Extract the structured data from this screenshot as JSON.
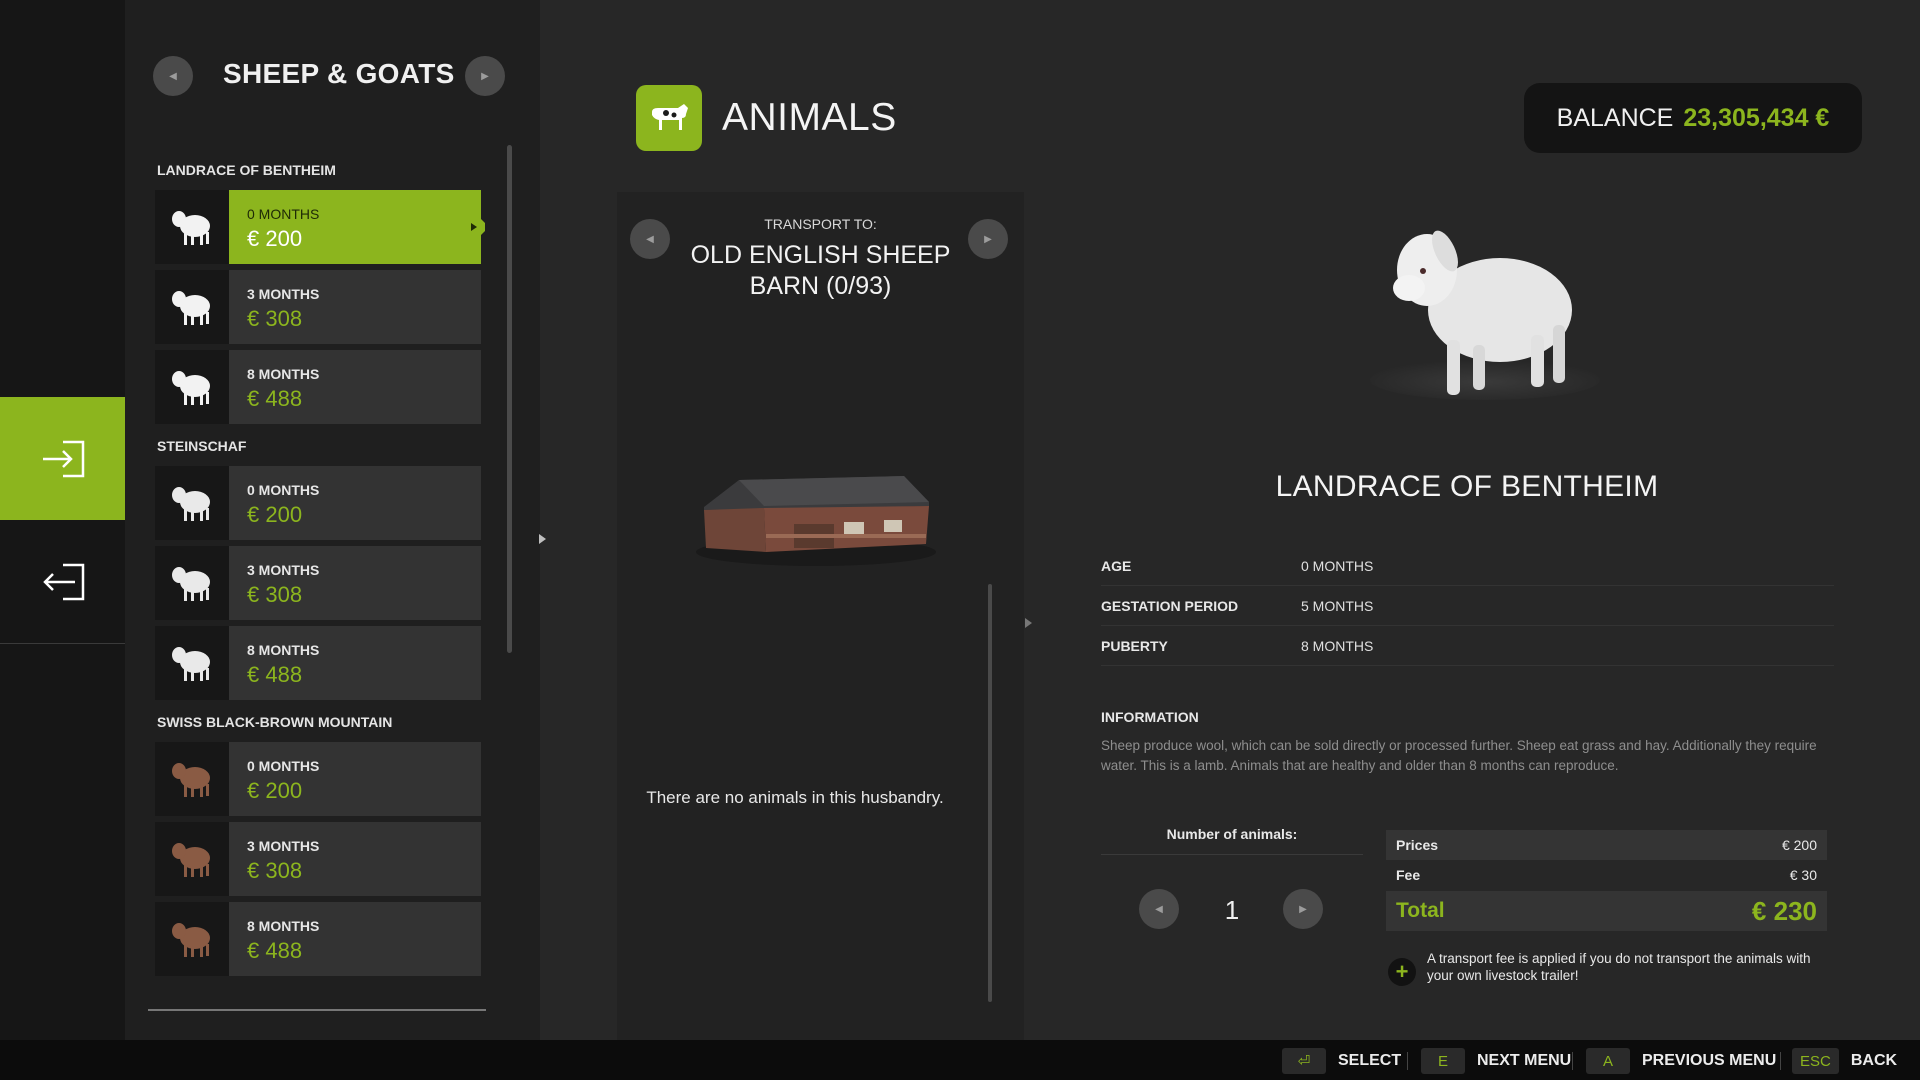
{
  "list": {
    "title": "SHEEP & GOATS",
    "groups": [
      {
        "name": "LANDRACE OF BENTHEIM",
        "wool_color": "#f2f2f2",
        "items": [
          {
            "age": "0 MONTHS",
            "price": "€ 200",
            "selected": true
          },
          {
            "age": "3 MONTHS",
            "price": "€ 308",
            "selected": false
          },
          {
            "age": "8 MONTHS",
            "price": "€ 488",
            "selected": false
          }
        ]
      },
      {
        "name": "STEINSCHAF",
        "wool_color": "#e9e9e9",
        "items": [
          {
            "age": "0 MONTHS",
            "price": "€ 200",
            "selected": false
          },
          {
            "age": "3 MONTHS",
            "price": "€ 308",
            "selected": false
          },
          {
            "age": "8 MONTHS",
            "price": "€ 488",
            "selected": false
          }
        ]
      },
      {
        "name": "SWISS BLACK-BROWN MOUNTAIN",
        "wool_color": "#8a5b44",
        "items": [
          {
            "age": "0 MONTHS",
            "price": "€ 200",
            "selected": false
          },
          {
            "age": "3 MONTHS",
            "price": "€ 308",
            "selected": false
          },
          {
            "age": "8 MONTHS",
            "price": "€ 488",
            "selected": false
          }
        ]
      }
    ]
  },
  "header": {
    "title": "ANIMALS",
    "icon": "cow-icon",
    "balance_label": "BALANCE",
    "balance_value": "23,305,434 €"
  },
  "transport": {
    "label": "TRANSPORT TO:",
    "destination": "OLD ENGLISH SHEEP BARN (0/93)",
    "empty_message": "There are no animals in this husbandry."
  },
  "detail": {
    "breed": "LANDRACE OF BENTHEIM",
    "stats": [
      {
        "label": "AGE",
        "value": "0 MONTHS"
      },
      {
        "label": "GESTATION PERIOD",
        "value": "5 MONTHS"
      },
      {
        "label": "PUBERTY",
        "value": "8 MONTHS"
      }
    ],
    "info_heading": "INFORMATION",
    "info_text": "Sheep produce wool, which can be sold directly or processed further. Sheep eat grass and hay. Additionally they require water. This is a lamb. Animals that are healthy and older than 8 months can reproduce."
  },
  "purchase": {
    "number_label": "Number of animals:",
    "quantity": "1",
    "prices_label": "Prices",
    "prices_value": "€ 200",
    "fee_label": "Fee",
    "fee_value": "€ 30",
    "total_label": "Total",
    "total_value": "€ 230",
    "fee_note": "A transport fee is applied if you do not transport the animals with your own livestock trailer!"
  },
  "footer": {
    "hints": [
      {
        "key": "⏎",
        "label": "SELECT"
      },
      {
        "key": "E",
        "label": "NEXT MENU"
      },
      {
        "key": "A",
        "label": "PREVIOUS MENU"
      },
      {
        "key": "ESC",
        "label": "BACK"
      }
    ]
  },
  "colors": {
    "accent": "#8cb51e",
    "background": "#272727",
    "panel": "#1f1f1f"
  }
}
